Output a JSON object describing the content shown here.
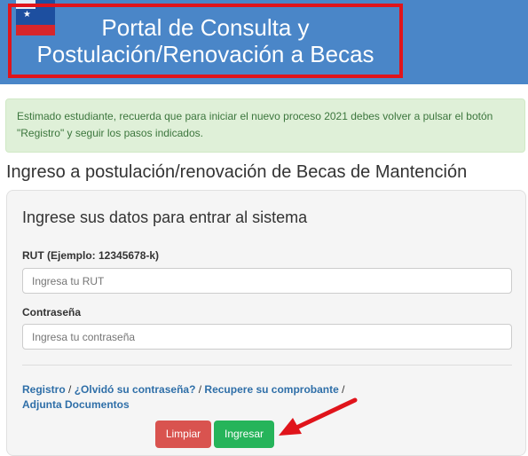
{
  "header": {
    "title_line1": "Portal de Consulta y",
    "title_line2": "Postulación/Renovación a Becas"
  },
  "alert": {
    "line1": "Estimado estudiante, recuerda que para iniciar el nuevo proceso 2021 debes volver a pulsar el botón",
    "line2": "\"Registro\" y seguir los pasos indicados."
  },
  "page_heading": "Ingreso a postulación/renovación de Becas de Mantención",
  "form": {
    "title": "Ingrese sus datos para entrar al sistema",
    "rut_label": "RUT (Ejemplo: 12345678-k)",
    "rut_placeholder": "Ingresa tu RUT",
    "password_label": "Contraseña",
    "password_placeholder": "Ingresa tu contraseña",
    "links": {
      "registro": "Registro",
      "olvido": "¿Olvidó su contraseña?",
      "recupere": "Recupere su comprobante",
      "adjunta": "Adjunta Documentos",
      "separator": " / "
    },
    "buttons": {
      "clear": "Limpiar",
      "login": "Ingresar"
    }
  },
  "colors": {
    "header_bg": "#4a86c8",
    "highlight_border": "#e0141b",
    "alert_bg": "#dff0d8",
    "link": "#2f6fa8",
    "clear_button": "#d9534f",
    "login_button": "#26b45a",
    "arrow": "#e0141b"
  },
  "icons": {
    "logo": "chile-government-logo-icon",
    "arrow": "red-arrow-icon"
  }
}
